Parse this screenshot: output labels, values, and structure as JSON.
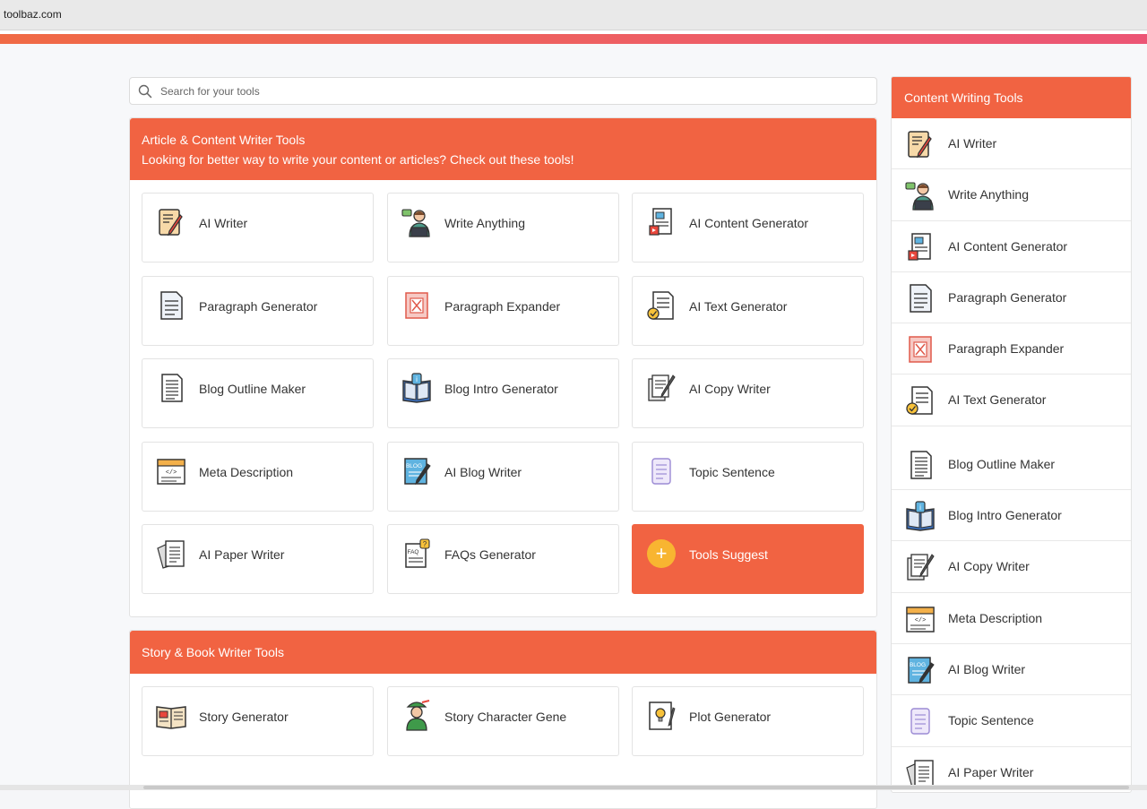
{
  "browser": {
    "url": "toolbaz.com"
  },
  "search": {
    "placeholder": "Search for your tools"
  },
  "section1": {
    "title": "Article & Content Writer Tools",
    "subtitle": "Looking for better way to write your content or articles? Check out these tools!",
    "tools": [
      {
        "label": "AI Writer",
        "icon": "pencil-paper-icon"
      },
      {
        "label": "Write Anything",
        "icon": "person-laptop-icon"
      },
      {
        "label": "AI Content Generator",
        "icon": "content-doc-icon"
      },
      {
        "label": "Paragraph Generator",
        "icon": "paragraph-doc-icon"
      },
      {
        "label": "Paragraph Expander",
        "icon": "expand-icon"
      },
      {
        "label": "AI Text Generator",
        "icon": "text-doc-check-icon"
      },
      {
        "label": "Blog Outline Maker",
        "icon": "outline-doc-icon"
      },
      {
        "label": "Blog Intro Generator",
        "icon": "book-info-icon"
      },
      {
        "label": "AI Copy Writer",
        "icon": "copy-pen-icon"
      },
      {
        "label": "Meta Description",
        "icon": "code-doc-icon"
      },
      {
        "label": "AI Blog Writer",
        "icon": "blog-pen-icon"
      },
      {
        "label": "Topic Sentence",
        "icon": "scroll-doc-icon"
      },
      {
        "label": "AI Paper Writer",
        "icon": "papers-icon"
      },
      {
        "label": "FAQs Generator",
        "icon": "faq-doc-icon"
      }
    ],
    "suggest_label": "Tools Suggest",
    "suggest_icon": "plus-icon"
  },
  "section2": {
    "title": "Story & Book Writer Tools",
    "tools": [
      {
        "label": "Story Generator",
        "icon": "open-book-icon"
      },
      {
        "label": "Story Character Gene",
        "icon": "character-icon"
      },
      {
        "label": "Plot Generator",
        "icon": "bulb-notebook-icon"
      }
    ]
  },
  "sidebar": {
    "title": "Content Writing Tools",
    "items": [
      {
        "label": "AI Writer",
        "icon": "pencil-paper-icon"
      },
      {
        "label": "Write Anything",
        "icon": "person-laptop-icon"
      },
      {
        "label": "AI Content Generator",
        "icon": "content-doc-icon"
      },
      {
        "label": "Paragraph Generator",
        "icon": "paragraph-doc-icon"
      },
      {
        "label": "Paragraph Expander",
        "icon": "expand-icon"
      },
      {
        "label": "AI Text Generator",
        "icon": "text-doc-check-icon"
      },
      {
        "label": "Blog Outline Maker",
        "icon": "outline-doc-icon"
      },
      {
        "label": "Blog Intro Generator",
        "icon": "book-info-icon"
      },
      {
        "label": "AI Copy Writer",
        "icon": "copy-pen-icon"
      },
      {
        "label": "Meta Description",
        "icon": "code-doc-icon"
      },
      {
        "label": "AI Blog Writer",
        "icon": "blog-pen-icon"
      },
      {
        "label": "Topic Sentence",
        "icon": "scroll-doc-icon"
      },
      {
        "label": "AI Paper Writer",
        "icon": "papers-icon"
      }
    ]
  },
  "colors": {
    "accent": "#f16342",
    "suggest_plus": "#f8b531"
  }
}
